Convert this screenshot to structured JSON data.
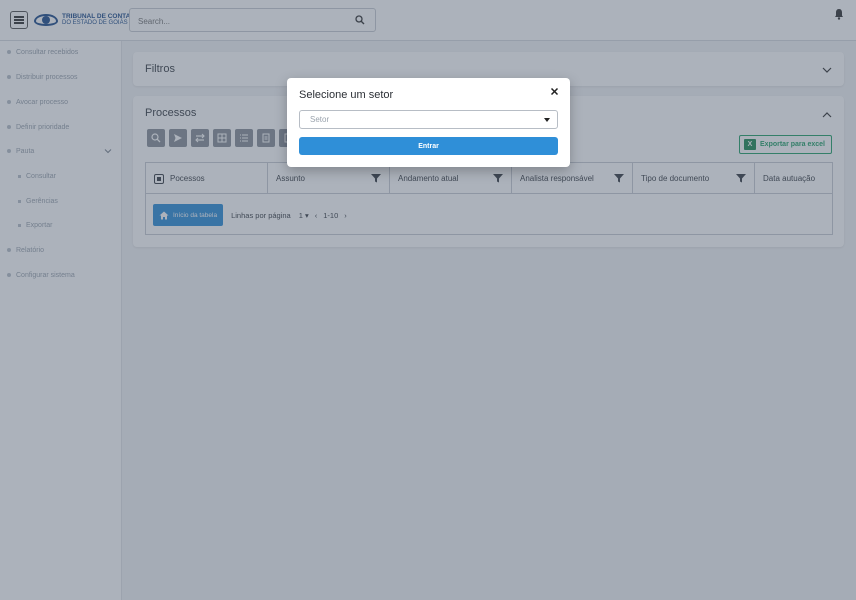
{
  "header": {
    "logo_line1": "TRIBUNAL DE CONTAS",
    "logo_line2": "DO ESTADO DE GOIÁS",
    "search_placeholder": "Search..."
  },
  "sidebar": {
    "items": [
      {
        "label": "Consultar recebidos"
      },
      {
        "label": "Distribuir processos"
      },
      {
        "label": "Avocar processo"
      },
      {
        "label": "Definir prioridade"
      },
      {
        "label": "Pauta"
      },
      {
        "label": "Consultar"
      },
      {
        "label": "Gerências"
      },
      {
        "label": "Exportar"
      },
      {
        "label": "Relatório"
      },
      {
        "label": "Configurar sistema"
      }
    ]
  },
  "filtros": {
    "title": "Filtros"
  },
  "processos": {
    "title": "Processos",
    "excel_label": "Exportar para excel",
    "excel_icon_text": "X",
    "columns": [
      "Pocessos",
      "Assunto",
      "Andamento atual",
      "Analista responsável",
      "Tipo de documento",
      "Data autuação"
    ],
    "start_label": "Início da tabela",
    "rows_per_page_label": "Linhas por página",
    "rows_per_page_value": "1",
    "range": "1-10"
  },
  "modal": {
    "title": "Selecione um setor",
    "select_placeholder": "Setor",
    "submit_label": "Entrar"
  },
  "colors": {
    "primary": "#2f8fd8",
    "excel_green": "#25a36b",
    "overlay": "rgba(70,85,105,0.45)"
  }
}
